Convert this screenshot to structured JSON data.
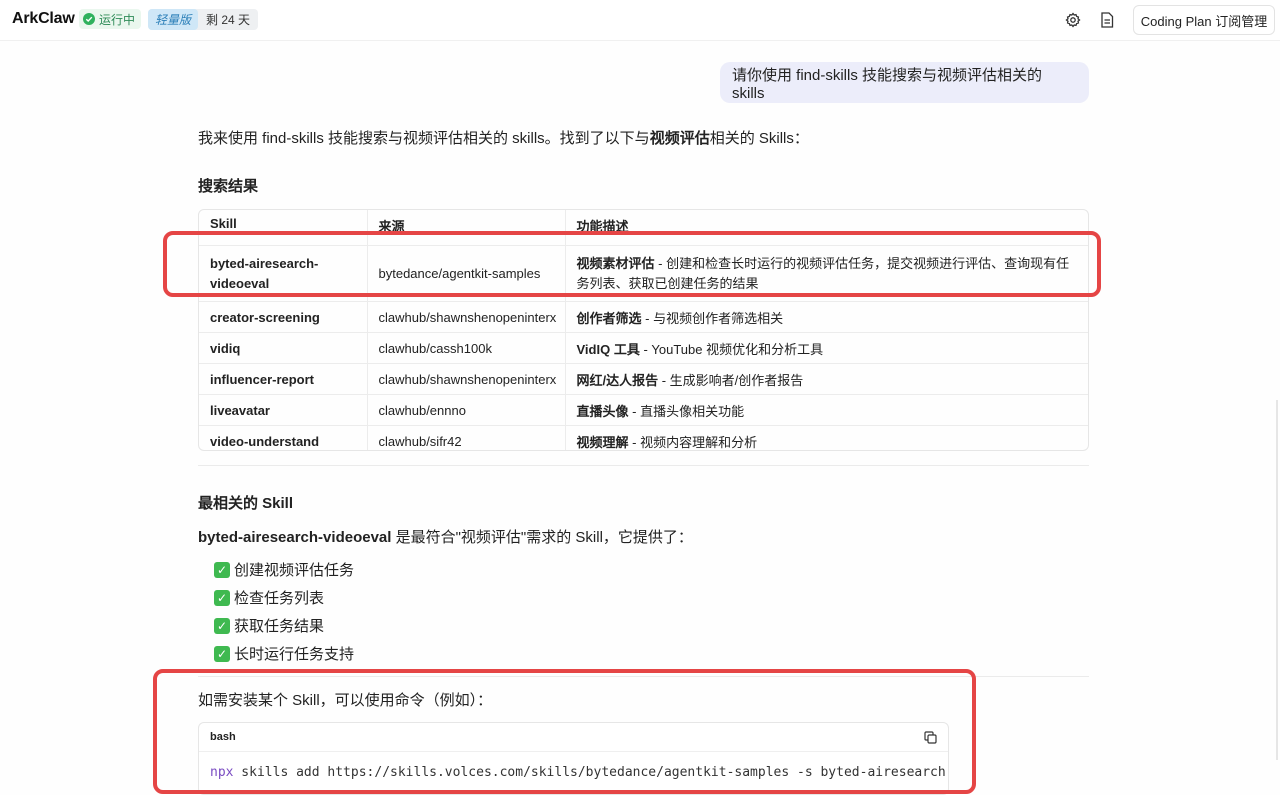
{
  "header": {
    "brand": "ArkClaw",
    "status": "运行中",
    "plan": "轻量版",
    "days_left": "剩 24 天",
    "coding_plan_button": "Coding Plan 订阅管理",
    "icons": [
      "gear-icon",
      "document-icon"
    ]
  },
  "chat": {
    "user_message": "请你使用 find-skills 技能搜索与视频评估相关的 skills",
    "intro_prefix": "我来使用 find-skills 技能搜索与视频评估相关的 skills。找到了以下与",
    "intro_bold": "视频评估",
    "intro_suffix": "相关的 Skills：",
    "search_heading": "搜索结果",
    "table": {
      "headers": [
        "Skill",
        "来源",
        "功能描述"
      ],
      "rows": [
        {
          "skill": "byted-airesearch-videoeval",
          "source": "bytedance/agentkit-samples",
          "desc_bold": "视频素材评估",
          "desc": " - 创建和检查长时运行的视频评估任务，提交视频进行评估、查询现有任务列表、获取已创建任务的结果"
        },
        {
          "skill": "creator-screening",
          "source": "clawhub/shawnshenopeninterx",
          "desc_bold": "创作者筛选",
          "desc": " - 与视频创作者筛选相关"
        },
        {
          "skill": "vidiq",
          "source": "clawhub/cassh100k",
          "desc_bold": "VidIQ 工具",
          "desc": " - YouTube 视频优化和分析工具"
        },
        {
          "skill": "influencer-report",
          "source": "clawhub/shawnshenopeninterx",
          "desc_bold": "网红/达人报告",
          "desc": " - 生成影响者/创作者报告"
        },
        {
          "skill": "liveavatar",
          "source": "clawhub/ennno",
          "desc_bold": "直播头像",
          "desc": " - 直播头像相关功能"
        },
        {
          "skill": "video-understand",
          "source": "clawhub/sifr42",
          "desc_bold": "视频理解",
          "desc": " - 视频内容理解和分析"
        }
      ]
    },
    "best_heading": "最相关的 Skill",
    "best_bold": "byted-airesearch-videoeval",
    "best_text": " 是最符合\"视频评估\"需求的 Skill，它提供了：",
    "features": [
      "创建视频评估任务",
      "检查任务列表",
      "获取任务结果",
      "长时运行任务支持"
    ],
    "install_text": "如需安装某个 Skill，可以使用命令（例如）：",
    "code": {
      "lang": "bash",
      "command_kw": "npx",
      "command_rest": " skills add https://skills.volces.com/skills/bytedance/agentkit-samples -s byted-airesearch-videoeval"
    }
  },
  "colors": {
    "highlight": "#e54545",
    "user_bubble": "#ecedfa",
    "status_green": "#2fb15d",
    "plan_blue": "#2b7fb8"
  }
}
